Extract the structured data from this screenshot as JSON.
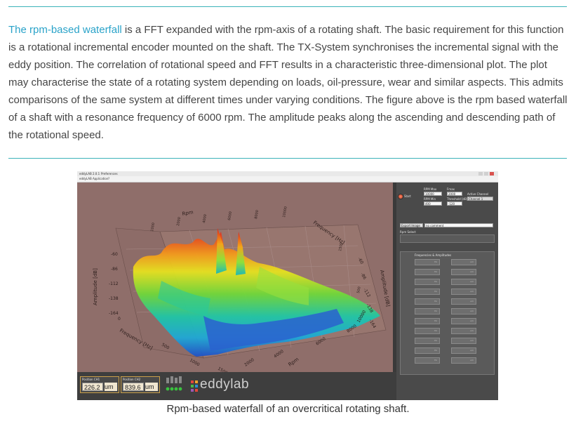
{
  "paragraph": {
    "link_text": "The rpm-based waterfall",
    "body": " is a FFT expanded with the rpm-axis of a rotating shaft. The basic requirement for this function is a rotational incremental encoder mounted on the shaft. The TX-System synchronises the incremental signal with the eddy position. The correlation of rotational speed and FFT results in a characteristic three-dimensional plot. The plot may characterise the state of a rotating system depending on loads, oil-pressure, wear and similar aspects. This admits comparisons of the same system at different times under varying conditions. The figure above is the rpm based waterfall of a shaft with a resonance frequency of 6000 rpm. The amplitude peaks along the ascending and descending path of the rotational speed."
  },
  "figure": {
    "window_title": "eddyLAB 2.0.1",
    "window_tab": "Preferences",
    "menu": [
      "eddyLAB",
      "Application",
      "?"
    ],
    "plot": {
      "rpm_axis_label": "Rpm",
      "frequency_axis_label": "Frequency [Hz]",
      "amplitude_axis_label_left": "Amplitude [dB]",
      "amplitude_axis_label_right": "Amplitude [dB]",
      "left_amp_ticks": [
        "-60",
        "-86",
        "-112",
        "-138",
        "-164"
      ],
      "right_amp_ticks": [
        "-60",
        "-86",
        "-112",
        "-138",
        "-164"
      ],
      "freq_front_ticks": [
        "0",
        "500",
        "1000",
        "1500"
      ],
      "rpm_front_ticks": [
        "2000",
        "4000",
        "6000",
        "8000",
        "10000"
      ],
      "rpm_front_label": "Rpm",
      "frequency_front_label": "Frequency [Hz]",
      "rpm_back_ticks": [
        "1000",
        "2000",
        "4000",
        "6000",
        "8000",
        "10000"
      ],
      "freq_right_ticks": [
        "1500",
        "500"
      ]
    },
    "panel": {
      "start_label": "Start",
      "rpm_max_label": "RPM Max",
      "rpm_max_value": "10000",
      "rpm_min_label": "RPM Min",
      "rpm_min_value": "400",
      "fmax_label": "Fmax",
      "fmax_value": "2000",
      "threshold_label": "Threshold [dB]",
      "threshold_value": "-120",
      "active_channel_label": "Active Channel",
      "active_channel_value": "Channel 1",
      "export_button": "Export Image",
      "comment_value": "no comment",
      "rpm_select_label": "Rpm Select",
      "freq_amp_label": "Frequencies & Amplitudes",
      "freq_unit": "Hz",
      "amp_unit": "um"
    },
    "status": {
      "pos1_label": "Position CH1",
      "pos1_value": "226.2",
      "pos1_unit": "um",
      "pos2_label": "Position CH2",
      "pos2_value": "839.6",
      "pos2_unit": "um",
      "logo_text": "eddylab"
    }
  },
  "caption": "Rpm-based waterfall of an overcritical rotating shaft."
}
